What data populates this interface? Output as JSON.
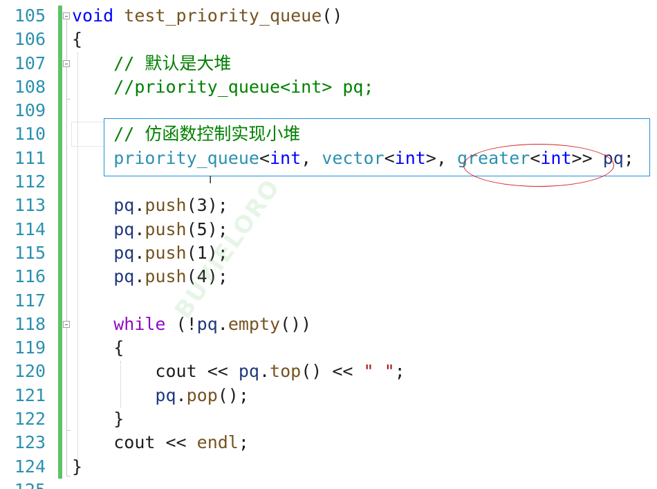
{
  "editor": {
    "line_numbers": [
      "105",
      "106",
      "107",
      "108",
      "109",
      "110",
      "111",
      "112",
      "113",
      "114",
      "115",
      "116",
      "117",
      "118",
      "119",
      "120",
      "121",
      "122",
      "123",
      "124"
    ],
    "partial_line_number": "125",
    "watermark": "BUYIELORO",
    "cursor_glyph": "I",
    "colors": {
      "line_number": "#2b91af",
      "keyword": "#0000ff",
      "control_keyword": "#8f08c4",
      "function": "#74531f",
      "variable": "#1f377f",
      "comment": "#008000",
      "string": "#a31515",
      "change_bar": "#5ec267",
      "selection_box": "#1e90d6",
      "annotation_ellipse": "#d42020"
    },
    "code": {
      "l105": {
        "kw": "void",
        "fn": "test_priority_queue",
        "rest": "()"
      },
      "l106": {
        "text": "{"
      },
      "l107": {
        "comment": "// 默认是大堆"
      },
      "l108": {
        "comment": "//priority_queue<int> pq;"
      },
      "l110": {
        "comment": "// 仿函数控制实现小堆"
      },
      "l111": {
        "type1": "priority_queue",
        "lt1": "<",
        "kw1": "int",
        "sep1": ", ",
        "type2": "vector",
        "lt2": "<",
        "kw2": "int",
        "gt2": ">, ",
        "type3": "greater",
        "lt3": "<",
        "kw3": "int",
        "gt3": ">> ",
        "var": "pq",
        "end": ";"
      },
      "l113": {
        "var": "pq",
        "dot": ".",
        "fn": "push",
        "args": "(3);"
      },
      "l114": {
        "var": "pq",
        "dot": ".",
        "fn": "push",
        "args": "(5);"
      },
      "l115": {
        "var": "pq",
        "dot": ".",
        "fn": "push",
        "args": "(1);"
      },
      "l116": {
        "var": "pq",
        "dot": ".",
        "fn": "push",
        "args": "(4);"
      },
      "l118": {
        "ctl": "while",
        "open": " (!",
        "var": "pq",
        "dot": ".",
        "fn": "empty",
        "close": "())"
      },
      "l119": {
        "text": "{"
      },
      "l120": {
        "cout": "cout",
        "op1": " << ",
        "var": "pq",
        "dot": ".",
        "fn": "top",
        "call": "()",
        "op2": " << ",
        "str": "\" \"",
        "end": ";"
      },
      "l121": {
        "var": "pq",
        "dot": ".",
        "fn": "pop",
        "rest": "();"
      },
      "l122": {
        "text": "}"
      },
      "l123": {
        "cout": "cout",
        "op": " << ",
        "endl": "endl",
        "end": ";"
      },
      "l124": {
        "text": "}"
      }
    }
  }
}
